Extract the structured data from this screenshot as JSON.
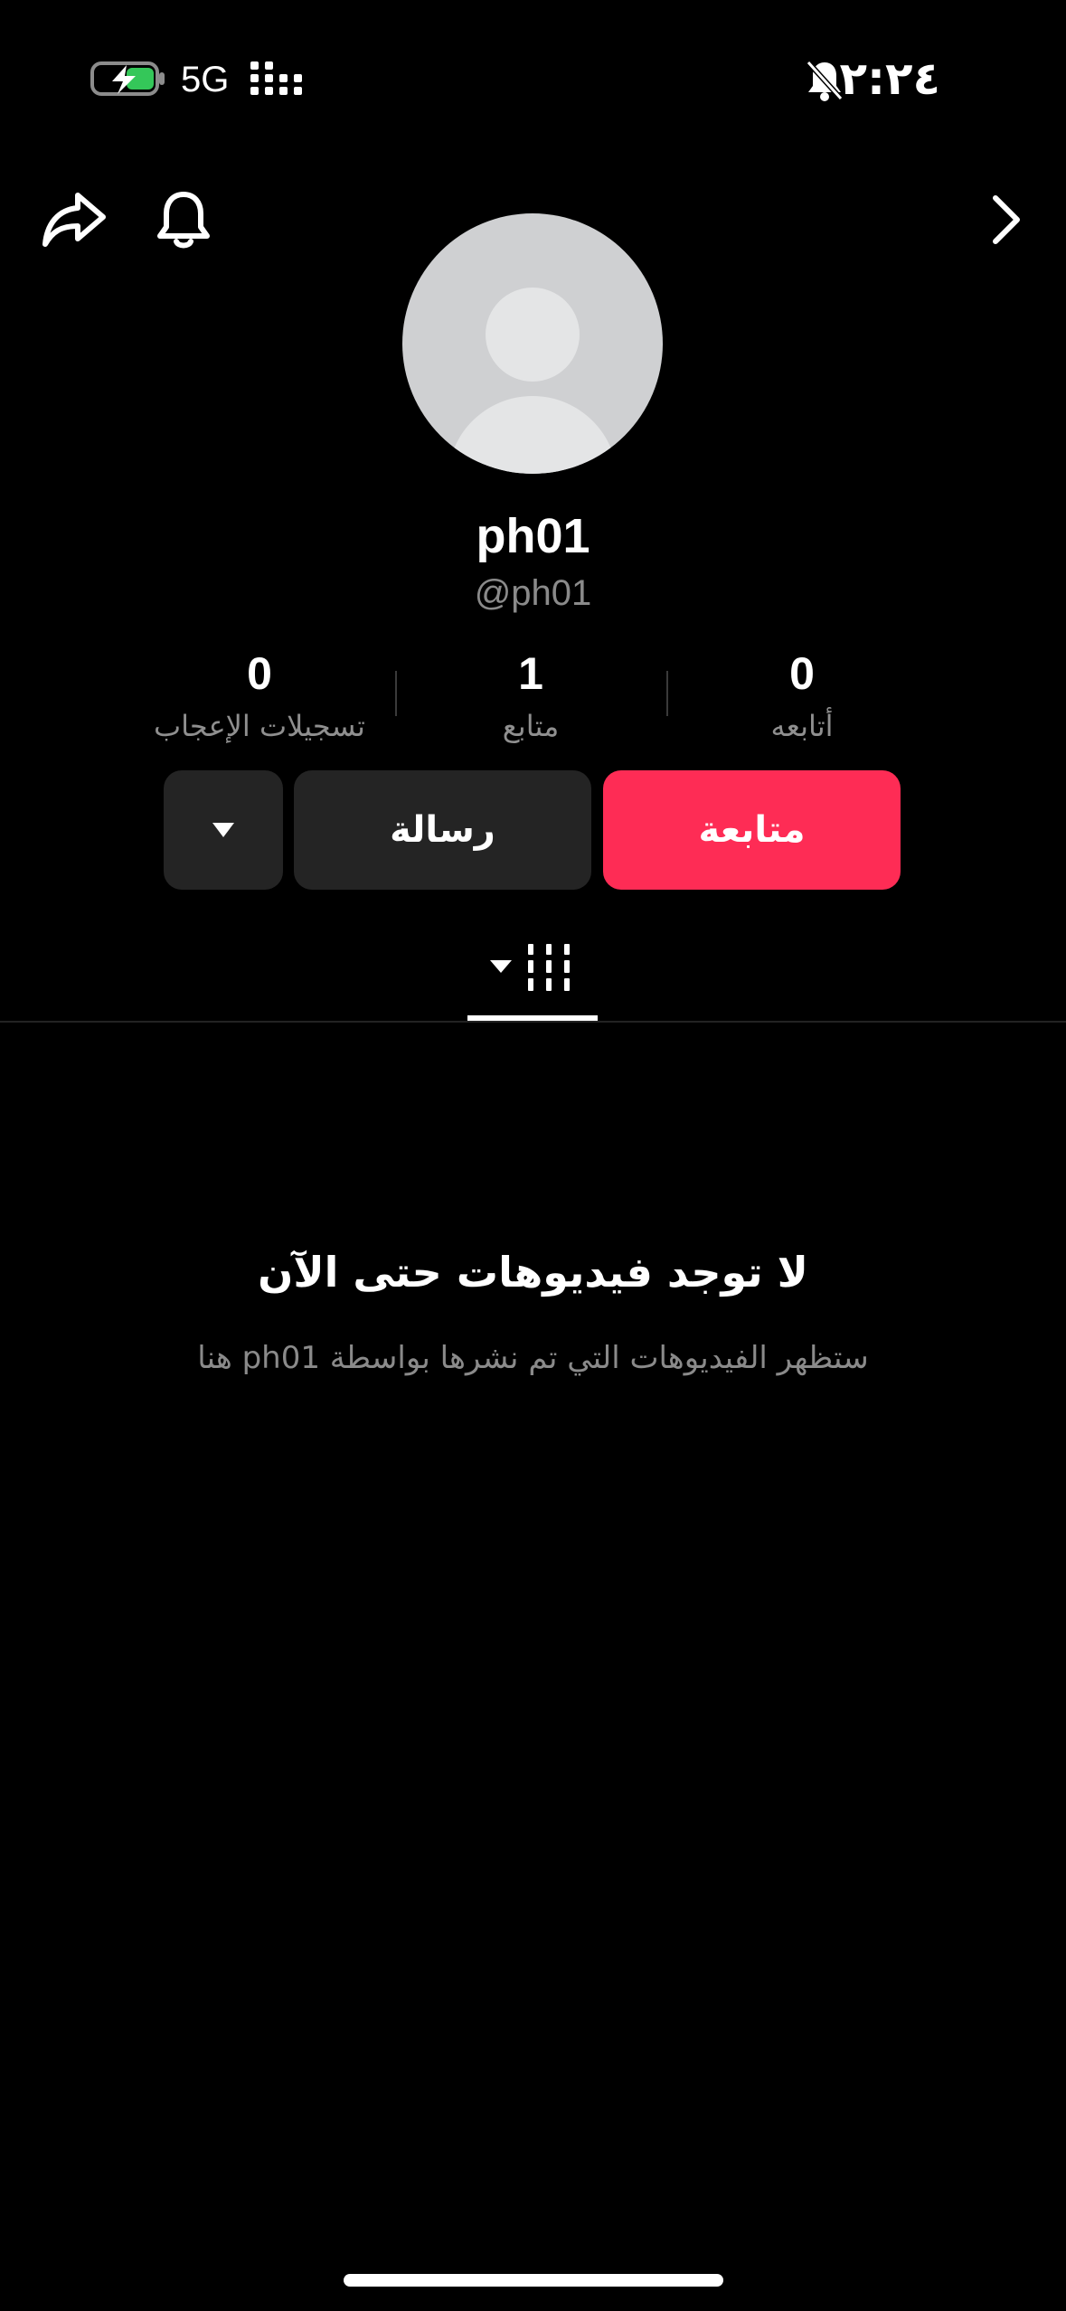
{
  "status_bar": {
    "time": "٢:٢٤",
    "network": "5G"
  },
  "profile": {
    "display_name": "ph01",
    "handle": "@ph01"
  },
  "stats": {
    "likes": {
      "value": "0",
      "label": "تسجيلات الإعجاب"
    },
    "followers": {
      "value": "1",
      "label": "متابع"
    },
    "following": {
      "value": "0",
      "label": "أتابعه"
    }
  },
  "actions": {
    "follow_label": "متابعة",
    "message_label": "رسالة"
  },
  "empty_state": {
    "title": "لا توجد فيديوهات حتى الآن",
    "subtitle": "ستظهر الفيديوهات التي تم نشرها بواسطة ph01 هنا"
  },
  "colors": {
    "accent": "#fe2c55",
    "background": "#000000",
    "button_dark": "#242424"
  }
}
